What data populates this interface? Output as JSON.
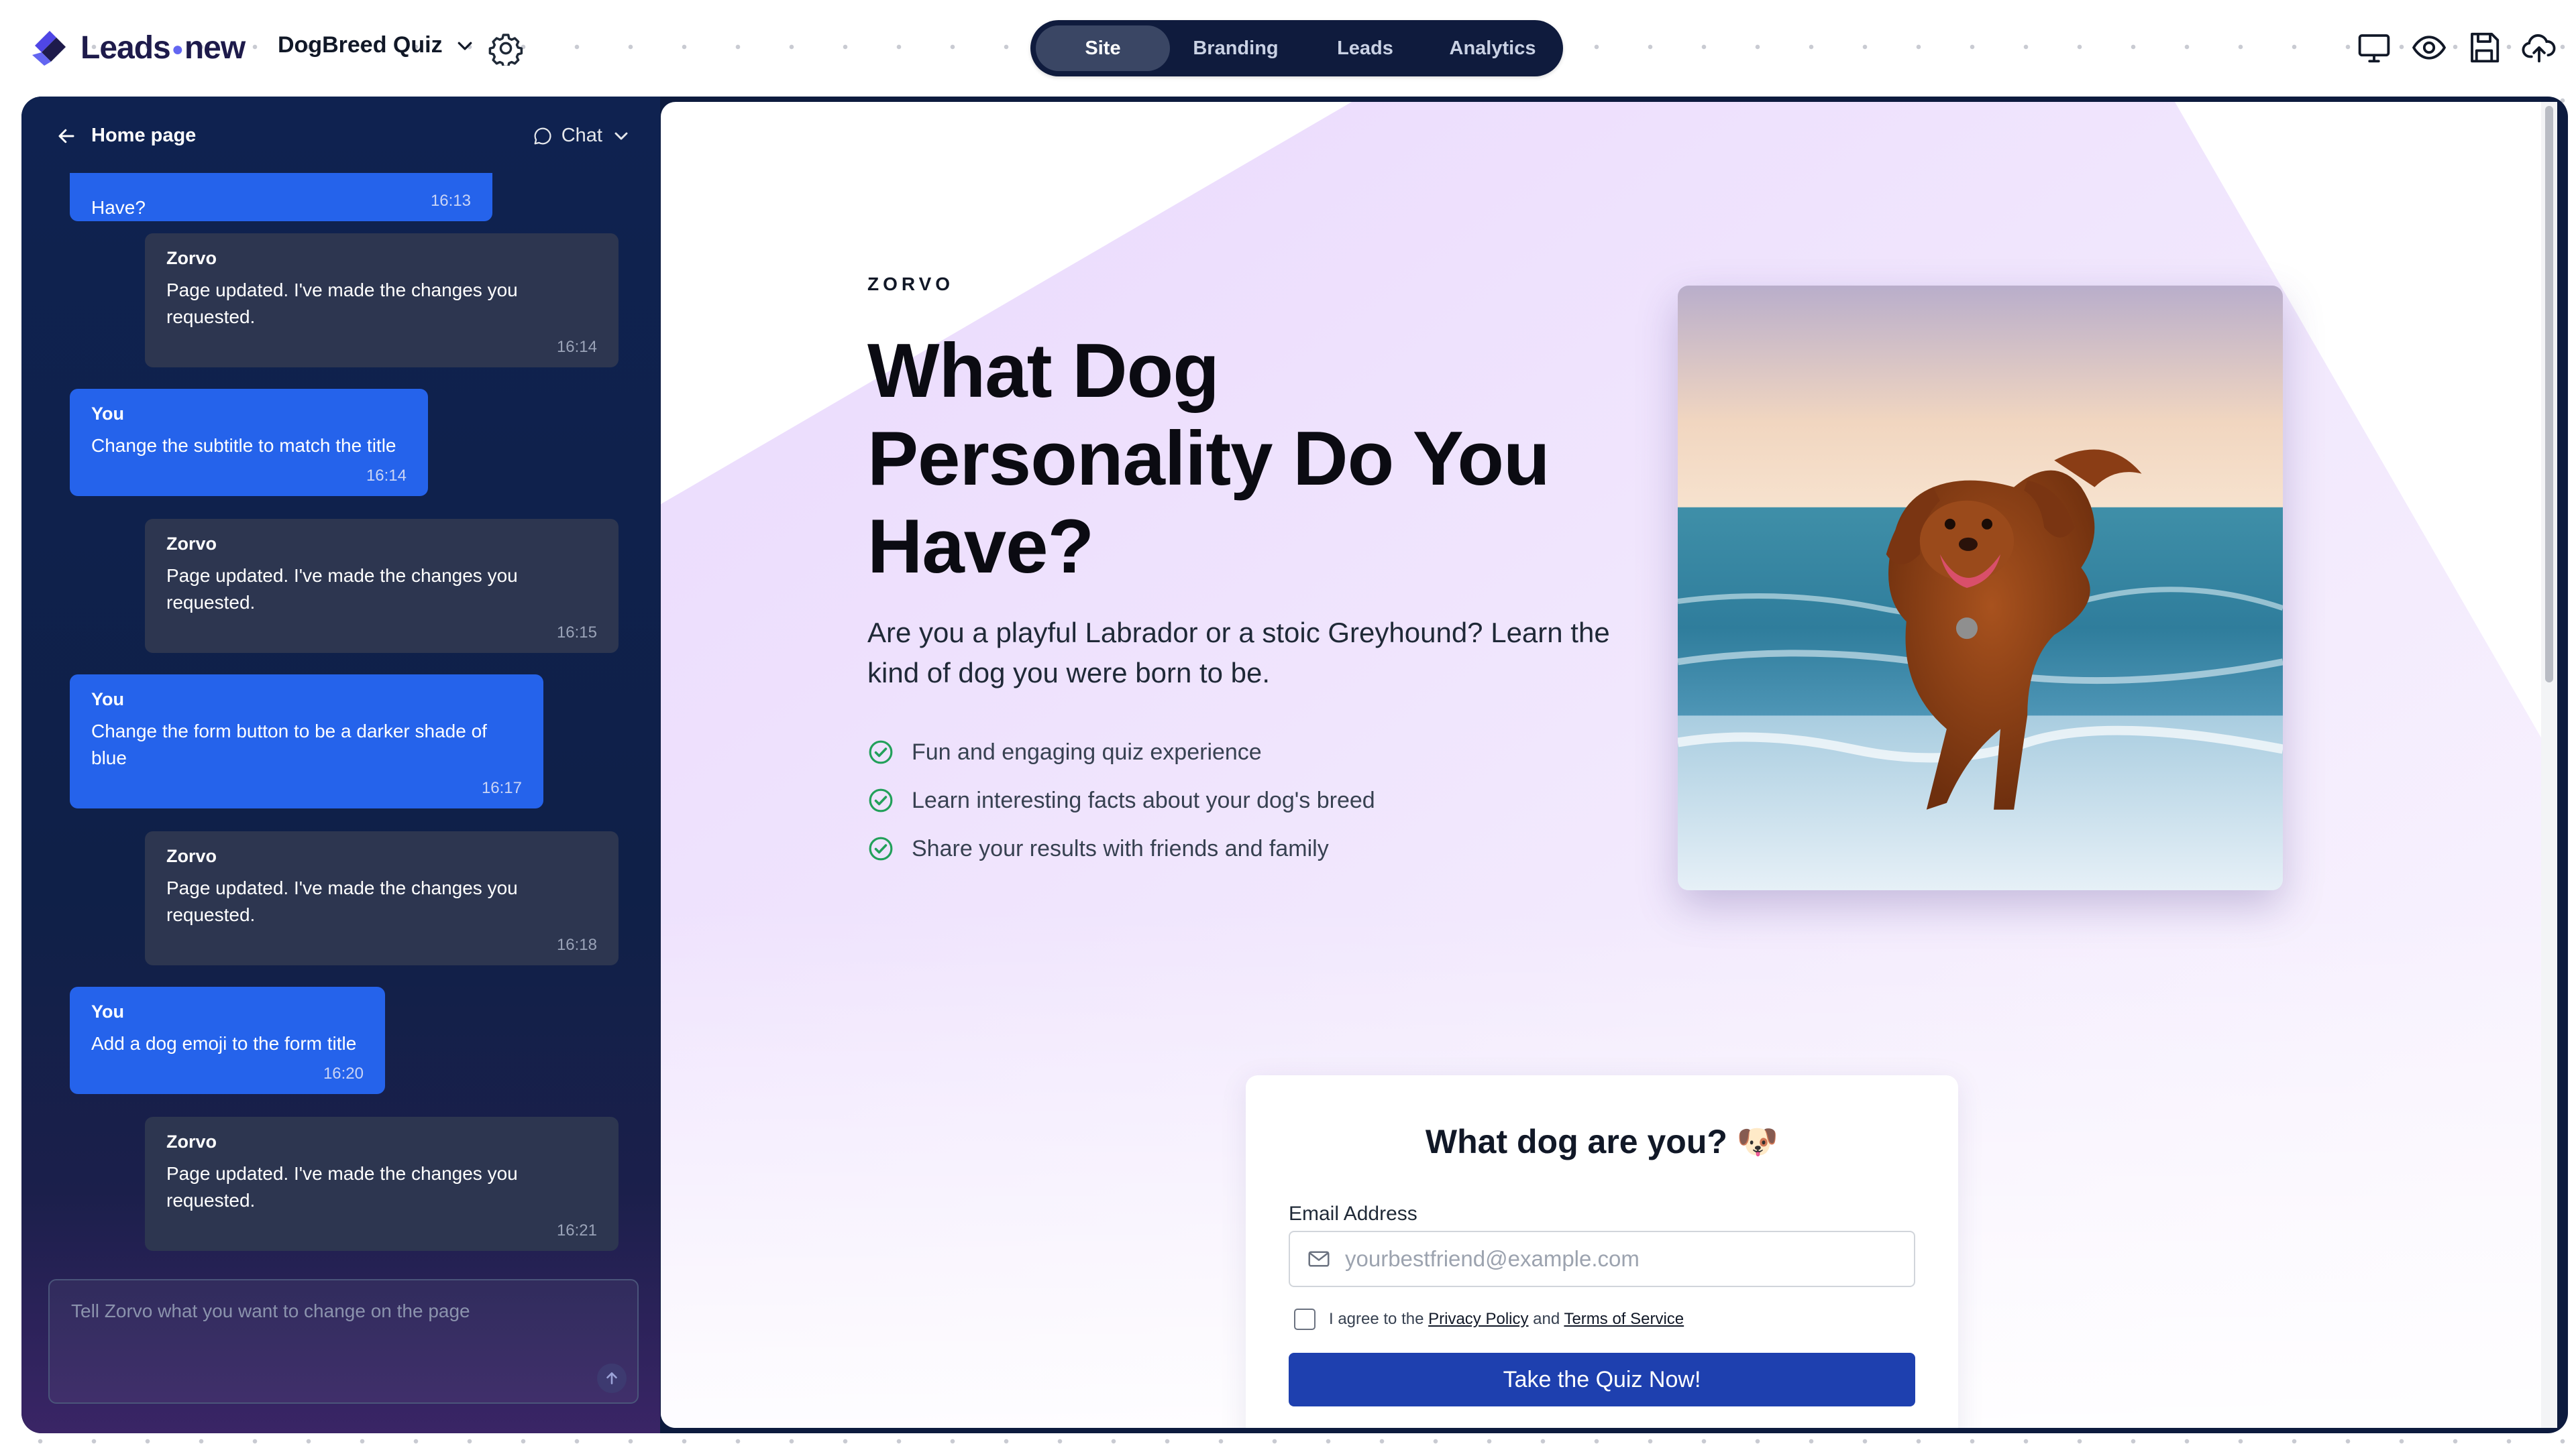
{
  "app": {
    "logo_text_a": "Leads",
    "logo_text_b": "new",
    "project_name": "DogBreed Quiz"
  },
  "tabs": [
    {
      "label": "Site",
      "active": true
    },
    {
      "label": "Branding",
      "active": false
    },
    {
      "label": "Leads",
      "active": false
    },
    {
      "label": "Analytics",
      "active": false
    }
  ],
  "toolbar_icons": [
    "desktop-icon",
    "eye-icon",
    "save-icon",
    "cloud-upload-icon"
  ],
  "chat": {
    "back_label": "Home page",
    "mode_label": "Chat",
    "input_placeholder": "Tell Zorvo what you want to change on the page",
    "messages": [
      {
        "sender": "",
        "text": "Have?",
        "time": "16:13",
        "role": "user"
      },
      {
        "sender": "Zorvo",
        "text": "Page updated. I've made the changes you requested.",
        "time": "16:14",
        "role": "bot"
      },
      {
        "sender": "You",
        "text": "Change the subtitle to match the title",
        "time": "16:14",
        "role": "user"
      },
      {
        "sender": "Zorvo",
        "text": "Page updated. I've made the changes you requested.",
        "time": "16:15",
        "role": "bot"
      },
      {
        "sender": "You",
        "text": "Change the form button to be a darker shade of blue",
        "time": "16:17",
        "role": "user"
      },
      {
        "sender": "Zorvo",
        "text": "Page updated. I've made the changes you requested.",
        "time": "16:18",
        "role": "bot"
      },
      {
        "sender": "You",
        "text": "Add a dog emoji to the form title",
        "time": "16:20",
        "role": "user"
      },
      {
        "sender": "Zorvo",
        "text": "Page updated. I've made the changes you requested.",
        "time": "16:21",
        "role": "bot"
      }
    ]
  },
  "page": {
    "brand": "ZORVO",
    "title": "What Dog Personality Do You Have?",
    "subtitle": "Are you a playful Labrador or a stoic Greyhound? Learn the kind of dog you were born to be.",
    "features": [
      "Fun and engaging quiz experience",
      "Learn interesting facts about your dog's breed",
      "Share your results with friends and family"
    ],
    "form": {
      "title": "What dog are you? 🐶",
      "email_label": "Email Address",
      "email_placeholder": "yourbestfriend@example.com",
      "agree_prefix": "I agree to the",
      "privacy_link": "Privacy Policy",
      "agree_and": "and",
      "terms_link": "Terms of Service",
      "cta_label": "Take the Quiz Now!"
    }
  },
  "colors": {
    "accent": "#2563eb",
    "cta": "#1e40af",
    "check": "#22a05a",
    "tabs_bg": "#0f1b3d"
  }
}
